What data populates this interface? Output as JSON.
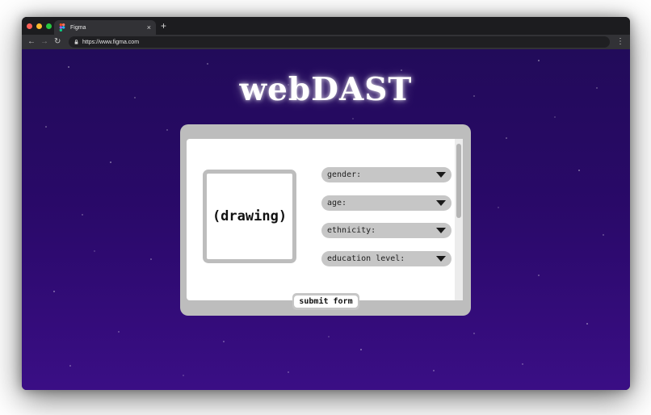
{
  "browser": {
    "tab_title": "Figma",
    "tab_close": "×",
    "new_tab": "+",
    "url": "https://www.figma.com",
    "nav": {
      "back": "←",
      "forward": "→",
      "reload": "↻",
      "menu": "⋮"
    },
    "traffic_lights": [
      "#ff5f57",
      "#febc2e",
      "#28c840"
    ]
  },
  "page": {
    "title": "webDAST",
    "drawing_label": "(drawing)",
    "fields": [
      {
        "label": "gender:"
      },
      {
        "label": "age:"
      },
      {
        "label": "ethnicity:"
      },
      {
        "label": "education level:"
      }
    ],
    "submit_label": "submit form"
  },
  "colors": {
    "background_top": "#220b5a",
    "background_bottom": "#3a0e85",
    "panel": "#bdbdbd",
    "field": "#c6c6c6"
  }
}
